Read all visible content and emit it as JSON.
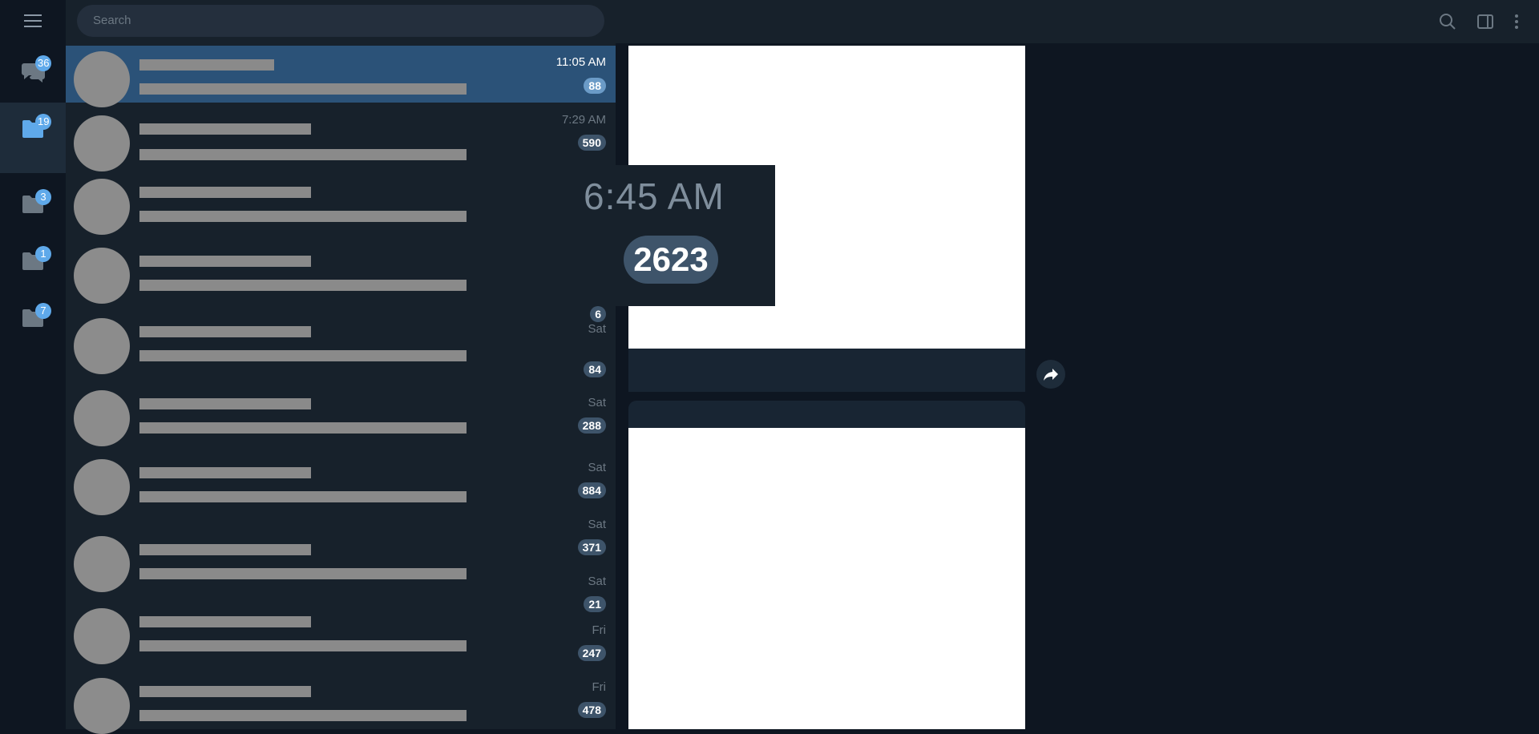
{
  "search": {
    "placeholder": "Search"
  },
  "folders": [
    {
      "name": "all-chats",
      "badge": "36"
    },
    {
      "name": "folder-1",
      "badge": "19"
    },
    {
      "name": "folder-2",
      "badge": "3"
    },
    {
      "name": "folder-3",
      "badge": "1"
    },
    {
      "name": "folder-4",
      "badge": "7"
    }
  ],
  "chats": [
    {
      "time": "11:05 AM",
      "badge": "88"
    },
    {
      "time": "7:29 AM",
      "badge": "590"
    },
    {
      "time": "",
      "badge": ""
    },
    {
      "time": "",
      "badge": "6"
    },
    {
      "time": "Sat",
      "badge": "84"
    },
    {
      "time": "Sat",
      "badge": "288"
    },
    {
      "time": "Sat",
      "badge": "884"
    },
    {
      "time": "Sat",
      "badge": "371"
    },
    {
      "time": "Sat",
      "badge": "21"
    },
    {
      "time": "Fri",
      "badge": "247"
    },
    {
      "time": "Fri",
      "badge": "478"
    }
  ],
  "zoom": {
    "time": "6:45 AM",
    "badge": "2623"
  },
  "colors": {
    "accent": "#5fa9ea",
    "active_row": "#2b5278",
    "panel": "#17212b",
    "background": "#0e1621"
  }
}
